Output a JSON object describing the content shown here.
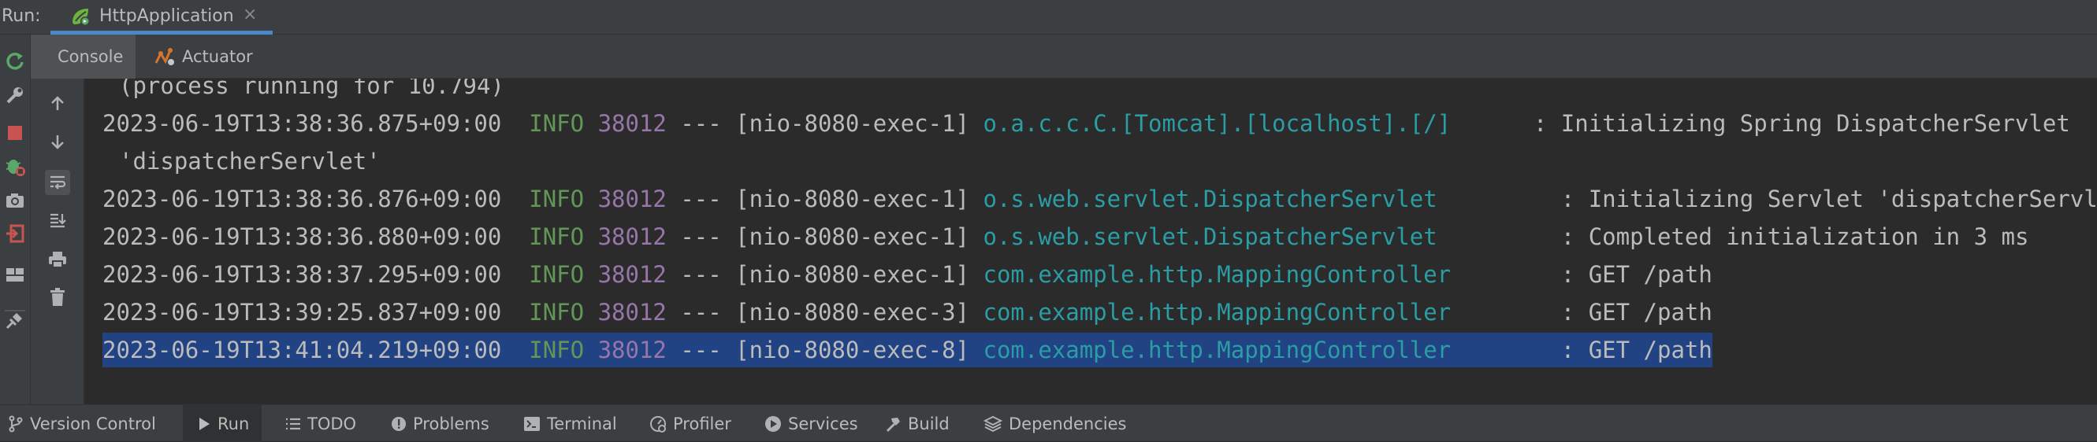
{
  "top": {
    "run_label": "Run:",
    "run_tab": "HttpApplication",
    "close_glyph": "×"
  },
  "subtabs": {
    "console": "Console",
    "actuator": "Actuator"
  },
  "console": {
    "lines": [
      {
        "text": "(process running for 10.794)"
      },
      {
        "ts": "2023-06-19T13:38:36.875+09:00",
        "level": "INFO",
        "pid": "38012",
        "sep": "---",
        "thread": "[nio-8080-exec-1]",
        "logger": "o.a.c.c.C.[Tomcat].[localhost].[/]",
        "msg": ": Initializing Spring DispatcherServlet"
      },
      {
        "text": "'dispatcherServlet'"
      },
      {
        "ts": "2023-06-19T13:38:36.876+09:00",
        "level": "INFO",
        "pid": "38012",
        "sep": "---",
        "thread": "[nio-8080-exec-1]",
        "logger": "o.s.web.servlet.DispatcherServlet",
        "msg": ": Initializing Servlet 'dispatcherServlet'"
      },
      {
        "ts": "2023-06-19T13:38:36.880+09:00",
        "level": "INFO",
        "pid": "38012",
        "sep": "---",
        "thread": "[nio-8080-exec-1]",
        "logger": "o.s.web.servlet.DispatcherServlet",
        "msg": ": Completed initialization in 3 ms"
      },
      {
        "ts": "2023-06-19T13:38:37.295+09:00",
        "level": "INFO",
        "pid": "38012",
        "sep": "---",
        "thread": "[nio-8080-exec-1]",
        "logger": "com.example.http.MappingController",
        "msg": ": GET /path"
      },
      {
        "ts": "2023-06-19T13:39:25.837+09:00",
        "level": "INFO",
        "pid": "38012",
        "sep": "---",
        "thread": "[nio-8080-exec-3]",
        "logger": "com.example.http.MappingController",
        "msg": ": GET /path"
      },
      {
        "ts": "2023-06-19T13:41:04.219+09:00",
        "level": "INFO",
        "pid": "38012",
        "sep": "---",
        "thread": "[nio-8080-exec-8]",
        "logger": "com.example.http.MappingController",
        "msg": ": GET /path",
        "selected": true
      }
    ]
  },
  "bottom": {
    "tabs": [
      {
        "label": "Version Control",
        "icon": "branch-icon"
      },
      {
        "label": "Run",
        "icon": "run-icon",
        "active": true
      },
      {
        "label": "TODO",
        "icon": "list-icon"
      },
      {
        "label": "Problems",
        "icon": "problems-icon"
      },
      {
        "label": "Terminal",
        "icon": "terminal-icon"
      },
      {
        "label": "Profiler",
        "icon": "profiler-icon"
      },
      {
        "label": "Services",
        "icon": "services-icon"
      },
      {
        "label": "Build",
        "icon": "hammer-icon"
      },
      {
        "label": "Dependencies",
        "icon": "layers-icon"
      }
    ]
  },
  "colors": {
    "background": "#2b2b2b",
    "panel": "#3c3f41",
    "info": "#629755",
    "pid": "#9876aa",
    "logger": "#2b9da5",
    "selection": "#214283",
    "accent": "#4a88c7"
  }
}
